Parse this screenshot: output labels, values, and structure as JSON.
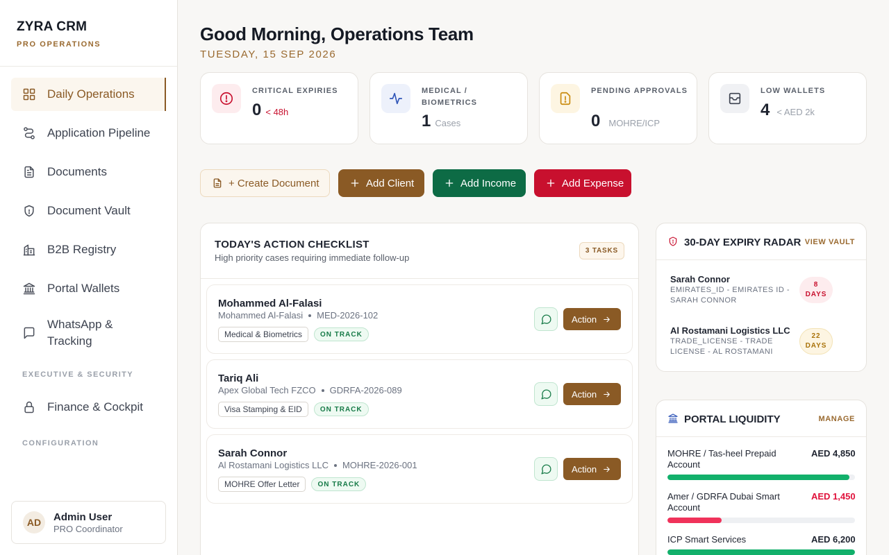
{
  "brand": {
    "name": "ZYRA CRM",
    "subtitle": "PRO OPERATIONS"
  },
  "nav": {
    "items": [
      {
        "label": "Daily Operations",
        "icon": "dashboard-icon",
        "active": true
      },
      {
        "label": "Application Pipeline",
        "icon": "route-icon"
      },
      {
        "label": "Documents",
        "icon": "file-text-icon"
      },
      {
        "label": "Document Vault",
        "icon": "shield-icon"
      },
      {
        "label": "B2B Registry",
        "icon": "building-icon"
      },
      {
        "label": "Portal Wallets",
        "icon": "landmark-icon"
      },
      {
        "label": "WhatsApp & Tracking",
        "icon": "message-square-icon"
      }
    ],
    "section_exec": "EXECUTIVE & SECURITY",
    "finance": {
      "label": "Finance & Cockpit",
      "icon": "lock-icon"
    },
    "section_config": "CONFIGURATION"
  },
  "user": {
    "initials": "AD",
    "name": "Admin User",
    "role": "PRO Coordinator"
  },
  "header": {
    "greeting": "Good Morning, Operations Team",
    "date": "TUESDAY, 15 SEP 2026"
  },
  "stats": [
    {
      "label": "CRITICAL EXPIRIES",
      "value": "0",
      "sub": "< 48h",
      "icon": "alert-circle-icon",
      "color": "#c8102e"
    },
    {
      "label": "MEDICAL / BIOMETRICS",
      "value": "1",
      "sub": "Cases",
      "icon": "activity-icon",
      "color": "#2f55b8"
    },
    {
      "label": "PENDING APPROVALS",
      "value": "0",
      "sub": "MOHRE/ICP",
      "icon": "file-warning-icon",
      "color": "#c98a0c"
    },
    {
      "label": "LOW WALLETS",
      "value": "4",
      "sub": "< AED 2k",
      "icon": "wallet-icon",
      "color": "#3d4350"
    }
  ],
  "actions": {
    "create_document": "+ Create Document",
    "add_client": "Add Client",
    "add_income": "Add Income",
    "add_expense": "Add Expense"
  },
  "checklist": {
    "title": "TODAY'S ACTION CHECKLIST",
    "subtitle": "High priority cases requiring immediate follow-up",
    "badge": "3 TASKS",
    "action_label": "Action",
    "rows": [
      {
        "name": "Mohammed Al-Falasi",
        "company": "Mohammed Al-Falasi",
        "ref": "MED-2026-102",
        "service": "Medical & Biometrics",
        "status": "ON TRACK"
      },
      {
        "name": "Tariq Ali",
        "company": "Apex Global Tech FZCO",
        "ref": "GDRFA-2026-089",
        "service": "Visa Stamping & EID",
        "status": "ON TRACK"
      },
      {
        "name": "Sarah Connor",
        "company": "Al Rostamani Logistics LLC",
        "ref": "MOHRE-2026-001",
        "service": "MOHRE Offer Letter",
        "status": "ON TRACK"
      }
    ]
  },
  "expiry": {
    "title": "30-DAY EXPIRY RADAR",
    "link": "VIEW VAULT",
    "items": [
      {
        "name": "Sarah Connor",
        "sub": "EMIRATES_ID - EMIRATES ID - SARAH CONNOR",
        "days_num": "8",
        "days_label": "DAYS",
        "tone": "red"
      },
      {
        "name": "Al Rostamani Logistics LLC",
        "sub": "TRADE_LICENSE - TRADE LICENSE - AL ROSTAMANI",
        "days_num": "22",
        "days_label": "DAYS",
        "tone": "amber"
      }
    ]
  },
  "liquidity": {
    "title": "PORTAL LIQUIDITY",
    "link": "MANAGE",
    "wallets": [
      {
        "name": "MOHRE / Tas-heel Prepaid Account",
        "amount": "AED 4,850",
        "fill_pct": 97,
        "color": "#12b06b",
        "amount_color": "#1f2430"
      },
      {
        "name": "Amer / GDRFA Dubai Smart Account",
        "amount": "AED 1,450",
        "fill_pct": 29,
        "color": "#f0325a",
        "amount_color": "#e0113b"
      },
      {
        "name": "ICP Smart Services",
        "amount": "AED 6,200",
        "fill_pct": 100,
        "color": "#12b06b",
        "amount_color": "#1f2430"
      }
    ]
  }
}
